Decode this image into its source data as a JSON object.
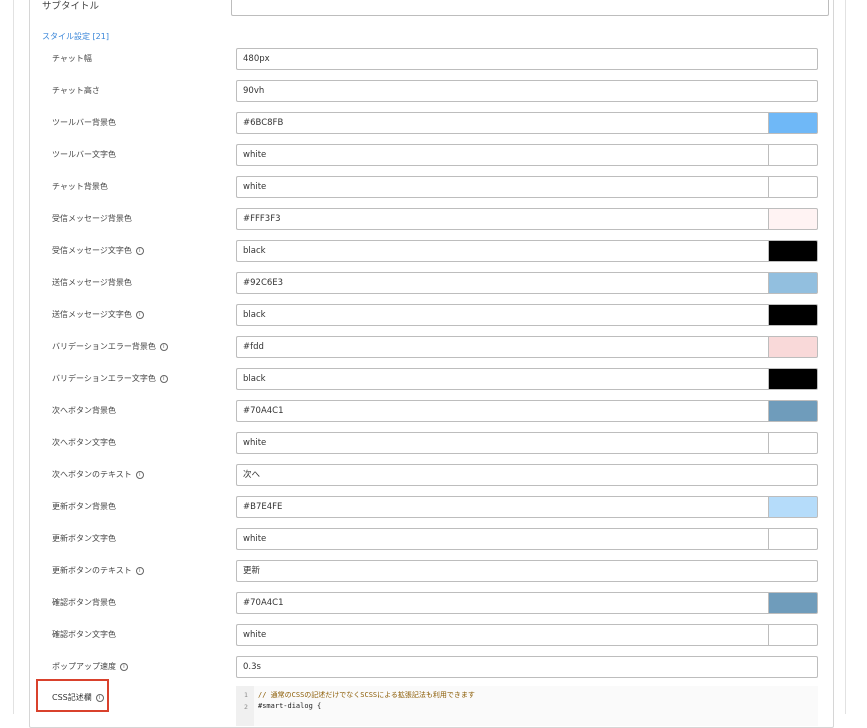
{
  "subtitle": {
    "label": "サブタイトル",
    "value": ""
  },
  "style_section": {
    "heading": "スタイル設定 [21]"
  },
  "fields": [
    {
      "label": "チャット幅",
      "value": "480px",
      "swatch": null,
      "info": false
    },
    {
      "label": "チャット高さ",
      "value": "90vh",
      "swatch": null,
      "info": false
    },
    {
      "label": "ツールバー背景色",
      "value": "#6BC8FB",
      "swatch": "#6fb8f7",
      "info": false
    },
    {
      "label": "ツールバー文字色",
      "value": "white",
      "swatch": "#ffffff",
      "info": false
    },
    {
      "label": "チャット背景色",
      "value": "white",
      "swatch": "#ffffff",
      "info": false
    },
    {
      "label": "受信メッセージ背景色",
      "value": "#FFF3F3",
      "swatch": "#fff3f3",
      "info": false
    },
    {
      "label": "受信メッセージ文字色",
      "value": "black",
      "swatch": "#000000",
      "info": true
    },
    {
      "label": "送信メッセージ背景色",
      "value": "#92C6E3",
      "swatch": "#92bfdf",
      "info": false
    },
    {
      "label": "送信メッセージ文字色",
      "value": "black",
      "swatch": "#000000",
      "info": true
    },
    {
      "label": "バリデーションエラー背景色",
      "value": "#fdd",
      "swatch": "#f9d9d9",
      "info": true
    },
    {
      "label": "バリデーションエラー文字色",
      "value": "black",
      "swatch": "#000000",
      "info": true
    },
    {
      "label": "次へボタン背景色",
      "value": "#70A4C1",
      "swatch": "#6f9cbb",
      "info": false
    },
    {
      "label": "次へボタン文字色",
      "value": "white",
      "swatch": "#ffffff",
      "info": false
    },
    {
      "label": "次へボタンのテキスト",
      "value": "次へ",
      "swatch": null,
      "info": true
    },
    {
      "label": "更新ボタン背景色",
      "value": "#B7E4FE",
      "swatch": "#b5dcfa",
      "info": false
    },
    {
      "label": "更新ボタン文字色",
      "value": "white",
      "swatch": "#ffffff",
      "info": false
    },
    {
      "label": "更新ボタンのテキスト",
      "value": "更新",
      "swatch": null,
      "info": true
    },
    {
      "label": "確認ボタン背景色",
      "value": "#70A4C1",
      "swatch": "#6f9cbb",
      "info": false
    },
    {
      "label": "確認ボタン文字色",
      "value": "white",
      "swatch": "#ffffff",
      "info": false
    },
    {
      "label": "ポップアップ速度",
      "value": "0.3s",
      "swatch": null,
      "info": true
    }
  ],
  "css_field": {
    "label": "CSS記述欄",
    "info_icon": "i",
    "code_lines": [
      {
        "no": "1",
        "text": "// 通常のCSSの記述だけでなくSCSSによる拡張記法も利用できます",
        "kind": "comment"
      },
      {
        "no": "2",
        "text": "#smart-dialog {",
        "kind": "plain"
      }
    ]
  },
  "icons": {
    "info": "info-circle-icon"
  }
}
